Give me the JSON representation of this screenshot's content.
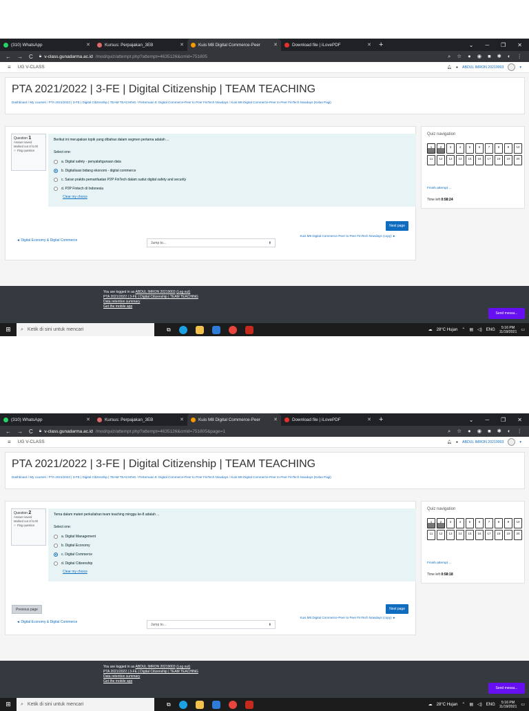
{
  "screens": [
    {
      "tabs": [
        {
          "label": "(310) WhatsApp",
          "color": "#25d366"
        },
        {
          "label": "Kursus: Perpajakan_3EB",
          "color": "#e06a6a"
        },
        {
          "label": "Kuis M8 Digital Commerce-Peer",
          "color": "#f29900"
        },
        {
          "label": "Download file | iLovePDF",
          "color": "#e5322d"
        }
      ],
      "new_tab": "+",
      "url_host": "v-class.gunadarma.ac.id",
      "url_path": "/mod/quiz/attempt.php?attempt=4635126&cmid=751805",
      "site_name": "UG V-CLASS",
      "user_name": "ABDUL IMRON 20219003",
      "course_title": "PTA 2021/2022 | 3-FE | Digital Citizenship | TEAM TEACHING",
      "breadcrumb": [
        "Dashboard",
        "My courses",
        "PTA 2021/2022 | 3-FE | Digital Citizenship | TEAM TEACHING",
        "Pertemuan 8: Digital Commerce-Peer to Peer FinTech Nowdays",
        "Kuis M8 Digital Commerce-Peer to Peer FinTech Nowdays (Kelas Pagi)"
      ],
      "question_label": "Question",
      "question_number": "1",
      "answer_status": "Answer saved",
      "marked_out_of": "Marked out of 5.00",
      "flag_label": "Flag question",
      "question_text": "Berikut ini merupakan topik yang dibahas dalam segmen pertama adalah ...",
      "select_one": "Select one:",
      "options": [
        {
          "label": "a. Digital safety - penyalahgunaan data",
          "selected": false
        },
        {
          "label": "b. Digitalisasi bidang ekonomi - digital commerce",
          "selected": true
        },
        {
          "label": "c. Saran praktis pemanfaatan P2P FinTech dalam sudut digital safety and security",
          "selected": false
        },
        {
          "label": "d. P2P Fintech di Indonesia",
          "selected": false
        }
      ],
      "clear_choice": "Clear my choice",
      "previous_page": "",
      "next_page": "Next page",
      "prev_activity": "◄ Digital Economy & Digital Commerce",
      "jump_to": "Jump to...",
      "next_activity": "Kuis M8 Digital Commerce-Peer to Peer FinTech Nowdays (copy) ►",
      "nav_title": "Quiz navigation",
      "nav_cells": [
        "1",
        "2",
        "3",
        "4",
        "5",
        "6",
        "7",
        "8",
        "9",
        "10",
        "11",
        "12",
        "13",
        "14",
        "15",
        "16",
        "17",
        "18",
        "19",
        "20"
      ],
      "answered": [
        1,
        2
      ],
      "current": 1,
      "finish_attempt": "Finish attempt ...",
      "time_left_label": "Time left",
      "time_left": "0:58:24",
      "footer": {
        "logged_in": "You are logged in as ",
        "user": "ABDUL IMRON 20219003",
        "logout": "(Log out)",
        "course": "PTA 2021/2022 | 3-FE | Digital Citizenship | TEAM TEACHING",
        "data_retention": "Data retention summary",
        "mobile": "Get the mobile app"
      },
      "send_message": "Send messa...",
      "taskbar_search": "Ketik di sini untuk mencari",
      "weather": "28°C Hujan",
      "lang": "ENG",
      "clock_time": "5:16 PM",
      "clock_date": "11/19/2021"
    },
    {
      "tabs": [
        {
          "label": "(310) WhatsApp",
          "color": "#25d366"
        },
        {
          "label": "Kursus: Perpajakan_3EB",
          "color": "#e06a6a"
        },
        {
          "label": "Kuis M8 Digital Commerce-Peer",
          "color": "#f29900"
        },
        {
          "label": "Download file | iLovePDF",
          "color": "#e5322d"
        }
      ],
      "new_tab": "+",
      "url_host": "v-class.gunadarma.ac.id",
      "url_path": "/mod/quiz/attempt.php?attempt=4635126&cmid=751805&page=1",
      "site_name": "UG V-CLASS",
      "user_name": "ABDUL IMRON 20219003",
      "course_title": "PTA 2021/2022 | 3-FE | Digital Citizenship | TEAM TEACHING",
      "breadcrumb": [
        "Dashboard",
        "My courses",
        "PTA 2021/2022 | 3-FE | Digital Citizenship | TEAM TEACHING",
        "Pertemuan 8: Digital Commerce-Peer to Peer FinTech Nowdays",
        "Kuis M8 Digital Commerce-Peer to Peer FinTech Nowdays (Kelas Pagi)"
      ],
      "question_label": "Question",
      "question_number": "2",
      "answer_status": "Answer saved",
      "marked_out_of": "Marked out of 5.00",
      "flag_label": "Flag question",
      "question_text": "Tema dalam materi perkuliahan team teaching minggu ke-8 adalah ...",
      "select_one": "Select one:",
      "options": [
        {
          "label": "a. Digital Management",
          "selected": false
        },
        {
          "label": "b. Digital Economy",
          "selected": false
        },
        {
          "label": "c. Digital Commerce",
          "selected": true
        },
        {
          "label": "d. Digital Citizenship",
          "selected": false
        }
      ],
      "clear_choice": "Clear my choice",
      "previous_page": "Previous page",
      "next_page": "Next page",
      "prev_activity": "◄ Digital Economy & Digital Commerce",
      "jump_to": "Jump to...",
      "next_activity": "Kuis M8 Digital Commerce-Peer to Peer FinTech Nowdays (copy) ►",
      "nav_title": "Quiz navigation",
      "nav_cells": [
        "1",
        "2",
        "3",
        "4",
        "5",
        "6",
        "7",
        "8",
        "9",
        "10",
        "11",
        "12",
        "13",
        "14",
        "15",
        "16",
        "17",
        "18",
        "19",
        "20"
      ],
      "answered": [
        1,
        2
      ],
      "current": 2,
      "finish_attempt": "Finish attempt ...",
      "time_left_label": "Time left",
      "time_left": "0:58:18",
      "footer": {
        "logged_in": "You are logged in as ",
        "user": "ABDUL IMRON 20219003",
        "logout": "(Log out)",
        "course": "PTA 2021/2022 | 3-FE | Digital Citizenship | TEAM TEACHING",
        "data_retention": "Data retention summary",
        "mobile": "Get the mobile app"
      },
      "send_message": "Send messa...",
      "taskbar_search": "Ketik di sini untuk mencari",
      "weather": "28°C Hujan",
      "lang": "ENG",
      "clock_time": "5:16 PM",
      "clock_date": "11/19/2021"
    }
  ]
}
